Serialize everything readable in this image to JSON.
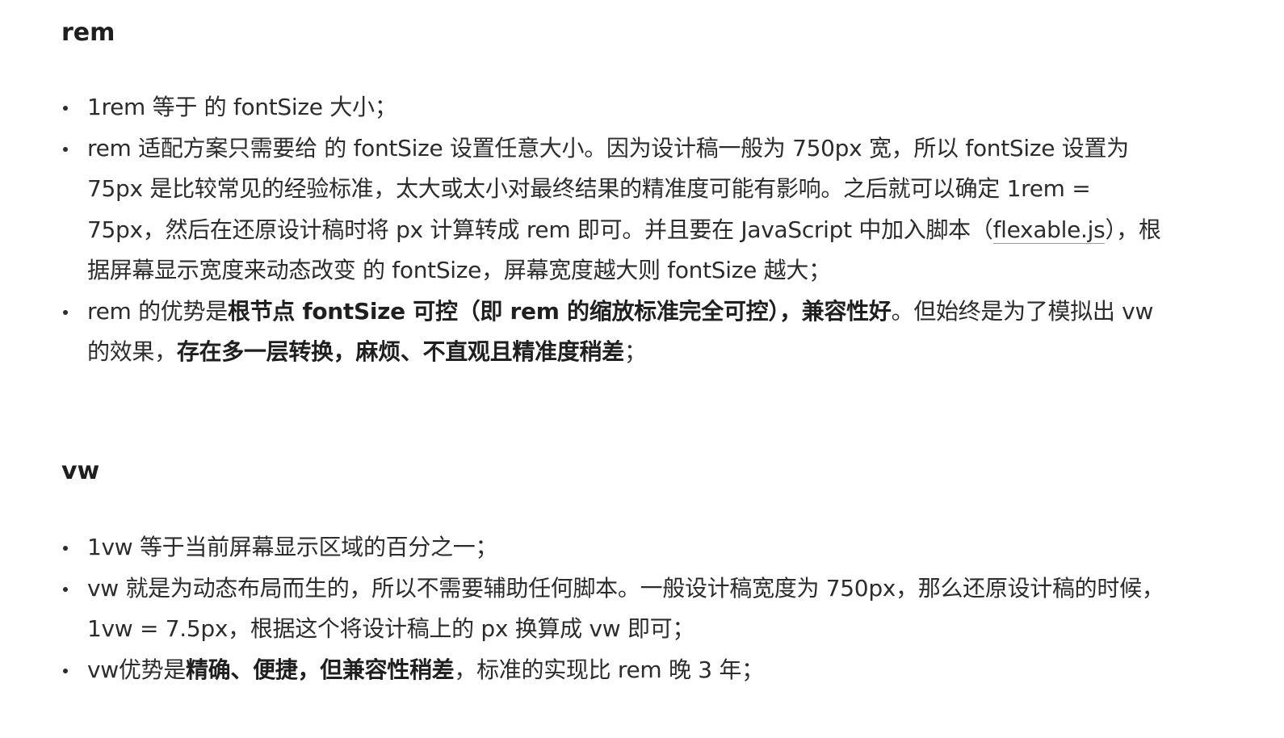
{
  "rem": {
    "title": "rem",
    "items": [
      {
        "t1": "1rem 等于 的 fontSize 大小；"
      },
      {
        "t1": "rem 适配方案只需要给 的 fontSize 设置任意大小。因为设计稿一般为 750px 宽，所以 fontSize 设置为 75px 是比较常见的经验标准，太大或太小对最终结果的精准度可能有影响。之后就可以确定 1rem = 75px，然后在还原设计稿时将 px 计算转成 rem 即可。并且要在 JavaScript 中加入脚本（",
        "link": "flexable.js",
        "t2": "），根据屏幕显示宽度来动态改变 的 fontSize，屏幕宽度越大则 fontSize 越大；"
      },
      {
        "t1": "rem 的优势是",
        "b1": "根节点 fontSize 可控（即 rem 的缩放标准完全可控），兼容性好",
        "t2": "。但始终是为了模拟出 vw 的效果，",
        "b2": "存在多一层转换，麻烦、不直观且精准度稍差",
        "t3": "；"
      }
    ]
  },
  "vw": {
    "title": "vw",
    "items": [
      {
        "t1": "1vw 等于当前屏幕显示区域的百分之一；"
      },
      {
        "t1": "vw 就是为动态布局而生的，所以不需要辅助任何脚本。一般设计稿宽度为 750px，那么还原设计稿的时候，1vw = 7.5px，根据这个将设计稿上的 px 换算成 vw 即可；"
      },
      {
        "t1": "vw优势是",
        "b1": "精确、便捷，但兼容性稍差",
        "t2": "，标准的实现比 rem 晚 3 年；"
      }
    ]
  }
}
